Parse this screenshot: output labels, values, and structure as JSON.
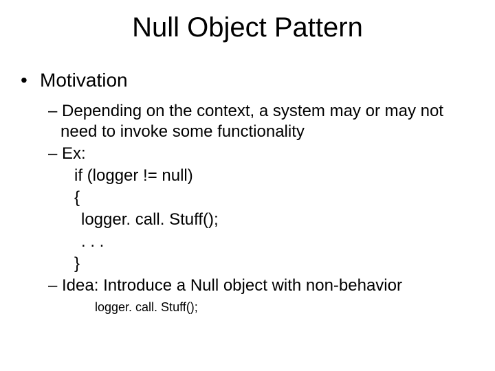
{
  "title": "Null Object Pattern",
  "bullets": {
    "motivation": "Motivation",
    "sub": {
      "context": "Depending on the context, a system may or may not need to invoke some functionality",
      "ex": "Ex:",
      "code": {
        "l1": "if (logger != null)",
        "l2": "{",
        "l3": "logger. call. Stuff();",
        "l4": ". . .",
        "l5": "}"
      },
      "idea": "Idea: Introduce a Null object with non-behavior",
      "footer_code": "logger. call. Stuff();"
    }
  }
}
